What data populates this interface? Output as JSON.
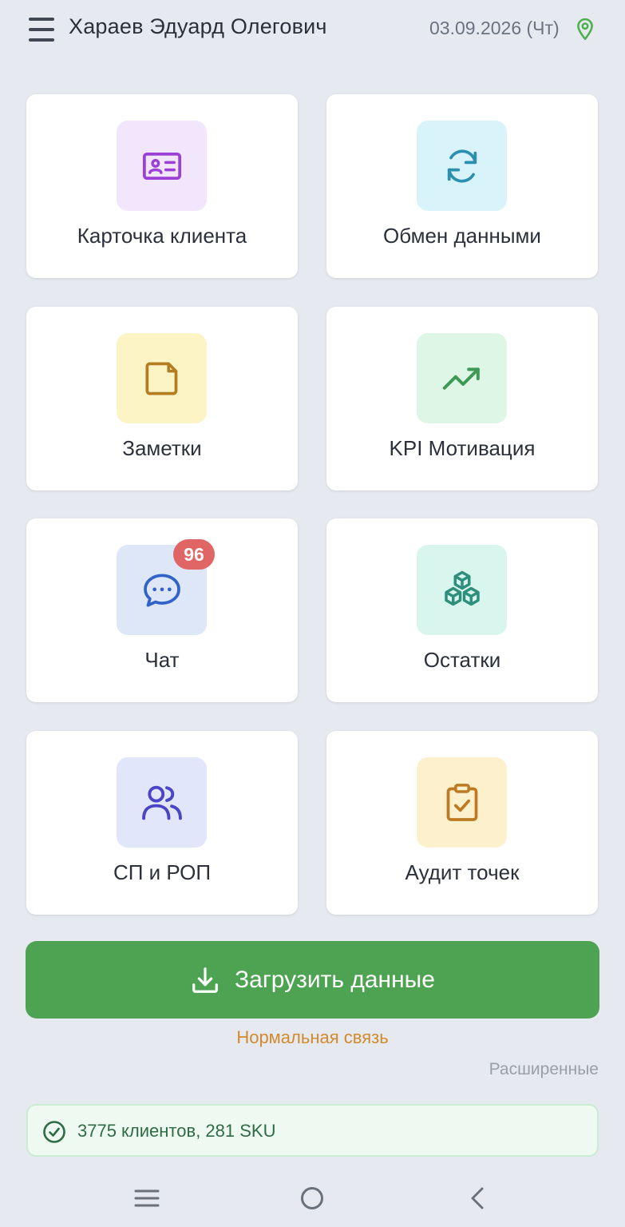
{
  "header": {
    "user_name": "Хараев Эдуард Олегович",
    "date": "03.09.2026 (Чт)",
    "menu_icon": "hamburger-menu-icon",
    "location_icon": "location-pin-icon",
    "location_color": "#4caf50"
  },
  "tiles": [
    {
      "label": "Карточка клиента",
      "icon": "id-card-icon",
      "icon_bg": "#f1e6fb",
      "icon_color": "#9b3fd6"
    },
    {
      "label": "Обмен данными",
      "icon": "sync-icon",
      "icon_bg": "#d9f3fa",
      "icon_color": "#2b8fb0"
    },
    {
      "label": "Заметки",
      "icon": "note-icon",
      "icon_bg": "#fcf4c5",
      "icon_color": "#b57d22"
    },
    {
      "label": "KPI Мотивация",
      "icon": "trending-up-icon",
      "icon_bg": "#def6e6",
      "icon_color": "#3c9a55"
    },
    {
      "label": "Чат",
      "icon": "chat-bubble-icon",
      "icon_bg": "#dde7f8",
      "icon_color": "#3162c9",
      "badge": "96"
    },
    {
      "label": "Остатки",
      "icon": "boxes-stack-icon",
      "icon_bg": "#d8f6ee",
      "icon_color": "#2f8f7c"
    },
    {
      "label": "СП и РОП",
      "icon": "users-icon",
      "icon_bg": "#e1e6fb",
      "icon_color": "#4a45c6"
    },
    {
      "label": "Аудит точек",
      "icon": "clipboard-check-icon",
      "icon_bg": "#fcf1cc",
      "icon_color": "#bd7a22"
    }
  ],
  "load_button": {
    "label": "Загрузить данные",
    "icon": "download-icon",
    "color": "#4ea352"
  },
  "connection_status": "Нормальная связь",
  "advanced_link": "Расширенные",
  "summary": {
    "text": "3775 клиентов, 281 SKU",
    "icon": "check-circle-icon"
  },
  "navbar": {
    "items": [
      "recent-apps-icon",
      "home-icon",
      "back-icon"
    ]
  }
}
